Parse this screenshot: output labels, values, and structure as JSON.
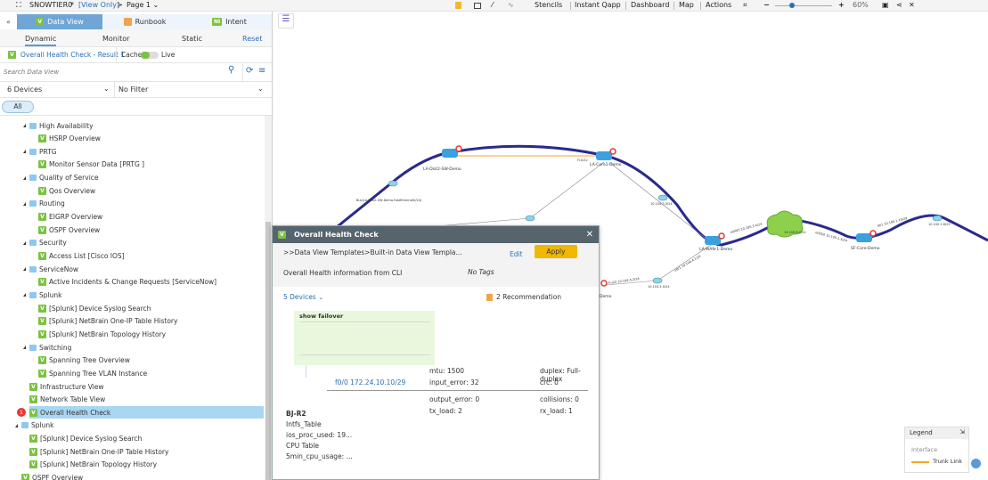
{
  "header": {
    "title": "SNOWTIER0",
    "modified": "*",
    "mode": "[View Only]",
    "page": "Page 1"
  },
  "toolbar": {
    "items": [
      "Stencils",
      "Instant Qapp",
      "Dashboard",
      "Map",
      "Actions"
    ],
    "zoom": "60%",
    "zoom_fraction": 0.3
  },
  "panel": {
    "tabs": [
      {
        "label": "Data View",
        "icon": "V",
        "active": true
      },
      {
        "label": "Runbook",
        "icon": ""
      },
      {
        "label": "Intent",
        "icon": "NI"
      }
    ],
    "subtabs": [
      "Dynamic",
      "Monitor",
      "Static"
    ],
    "reset": "Reset",
    "result": "Overall Health Check - Result 1",
    "cache": "Cache",
    "live": "Live",
    "search_placeholder": "Search Data View",
    "devices": "6 Devices",
    "filter": "No Filter",
    "chip": "All",
    "tree": [
      {
        "label": "High Availability",
        "type": "folder",
        "level": 1
      },
      {
        "label": "HSRP Overview",
        "type": "view",
        "level": 2
      },
      {
        "label": "PRTG",
        "type": "folder",
        "level": 1
      },
      {
        "label": "Monitor Sensor Data [PRTG ]",
        "type": "view",
        "level": 2
      },
      {
        "label": "Quality of Service",
        "type": "folder",
        "level": 1
      },
      {
        "label": "Qos Overview",
        "type": "view",
        "level": 2
      },
      {
        "label": "Routing",
        "type": "folder",
        "level": 1
      },
      {
        "label": "EIGRP Overview",
        "type": "view",
        "level": 2
      },
      {
        "label": "OSPF Overview",
        "type": "view",
        "level": 2
      },
      {
        "label": "Security",
        "type": "folder",
        "level": 1
      },
      {
        "label": "Access List [Cisco IOS]",
        "type": "view",
        "level": 2
      },
      {
        "label": "ServiceNow",
        "type": "folder",
        "level": 1
      },
      {
        "label": "Active Incidents & Change Requests [ServiceNow]",
        "type": "view",
        "level": 2
      },
      {
        "label": "Splunk",
        "type": "folder",
        "level": 1
      },
      {
        "label": "[Splunk] Device Syslog Search",
        "type": "view",
        "level": 2
      },
      {
        "label": "[Splunk] NetBrain One-IP Table History",
        "type": "view",
        "level": 2
      },
      {
        "label": "[Splunk] NetBrain Topology History",
        "type": "view",
        "level": 2
      },
      {
        "label": "Switching",
        "type": "folder",
        "level": 1
      },
      {
        "label": "Spanning Tree Overview",
        "type": "view",
        "level": 2
      },
      {
        "label": "Spanning Tree VLAN Instance",
        "type": "view",
        "level": 2
      },
      {
        "label": "Infrastructure View",
        "type": "view",
        "level": 1
      },
      {
        "label": "Network Table View",
        "type": "view",
        "level": 1
      },
      {
        "label": "Overall Health Check",
        "type": "view",
        "level": 1,
        "selected": true,
        "badge": "1"
      },
      {
        "label": "Splunk",
        "type": "folder",
        "level": 0
      },
      {
        "label": "[Splunk] Device Syslog Search",
        "type": "view",
        "level": 1
      },
      {
        "label": "[Splunk] NetBrain One-IP Table History",
        "type": "view",
        "level": 1
      },
      {
        "label": "[Splunk] NetBrain Topology History",
        "type": "view",
        "level": 1
      },
      {
        "label": "OSPF Overview",
        "type": "view",
        "level": 0
      }
    ]
  },
  "dialog": {
    "title": "Overall Health Check",
    "path": ">>Data View Templates>Built-in Data View Templa...",
    "edit": "Edit",
    "apply": "Apply",
    "description": "Overall Health information from CLI",
    "tags": "No Tags",
    "devices": "5 Devices",
    "recommendation": "2 Recommendation",
    "command": "show failover",
    "interface": "f0/0 172.24.10.10/29",
    "stats": [
      "mtu: 1500",
      "duplex: Full-duplex",
      "input_error: 32",
      "crc: 0",
      "output_error: 0",
      "collisions: 0",
      "tx_load: 2",
      "rx_load: 1"
    ],
    "device": "BJ-R2",
    "device_lines": [
      "Intfs_Table",
      "ios_proc_used: 19...",
      "CPU Table",
      "5min_cpu_usage: ..."
    ]
  },
  "map": {
    "nodes": [
      "LA-Dist2-SW-Demo",
      "LA-Core1-Demo",
      "LA-WAN-1-Demo",
      "SF-Core-Demo",
      "Demo"
    ],
    "subnets": [
      "10.104.3.0/24",
      "10.100.8.0/24",
      "10.100.1.8/29",
      "10.104.4.0/24"
    ],
    "links": [
      "Bus(LA-Dist2-SW-Demo.FastEthernet0/24)",
      "Fi.0/22",
      "e0/0/0 10.100.3.4/24",
      "e0/0/0 10.100.3.3/24",
      "f0/1 10.100.1.10/29",
      "Fi.0/2 10.104.4.2/24",
      "e0/1 10.104.4.1/24"
    ]
  },
  "legend": {
    "title": "Legend",
    "section": "Interface",
    "item": "Trunk Link",
    "item_color": "#f5a623",
    "path_color": "#2a2a8c"
  },
  "colors": {
    "accent": "#5b9bd5",
    "apply": "#f0b800",
    "selected": "#a9d6f2",
    "view_badge": "#7cc242"
  }
}
